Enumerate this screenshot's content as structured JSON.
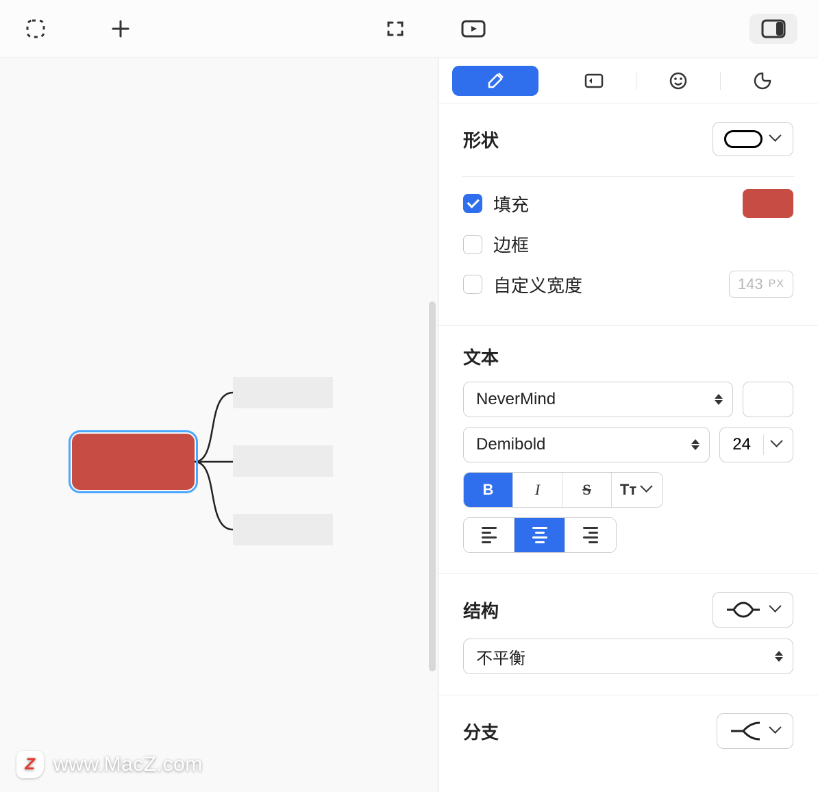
{
  "toolbar": {
    "select_icon": "select",
    "add_icon": "plus",
    "fullscreen_icon": "fullscreen",
    "presentation_icon": "presentation",
    "panel_toggle_icon": "panel-right"
  },
  "canvas": {
    "central_fill": "#c74c44"
  },
  "panel": {
    "tabs": {
      "style": "style",
      "label": "label",
      "emoji": "emoji",
      "sticker": "sticker"
    },
    "shape": {
      "title": "形状"
    },
    "fill": {
      "label": "填充",
      "checked": true,
      "color": "#c74c44"
    },
    "border": {
      "label": "边框",
      "checked": false
    },
    "custom_width": {
      "label": "自定义宽度",
      "checked": false,
      "value": "143",
      "unit": "PX"
    },
    "text": {
      "title": "文本",
      "font_family": "NeverMind",
      "font_weight": "Demibold",
      "font_size": "24",
      "bold": "B",
      "italic": "I",
      "strike": "S",
      "case": "Tᴛ"
    },
    "structure": {
      "title": "结构",
      "option": "不平衡"
    },
    "branch": {
      "title": "分支"
    }
  },
  "watermark": {
    "text": "www.MacZ.com",
    "badge": "Z"
  }
}
